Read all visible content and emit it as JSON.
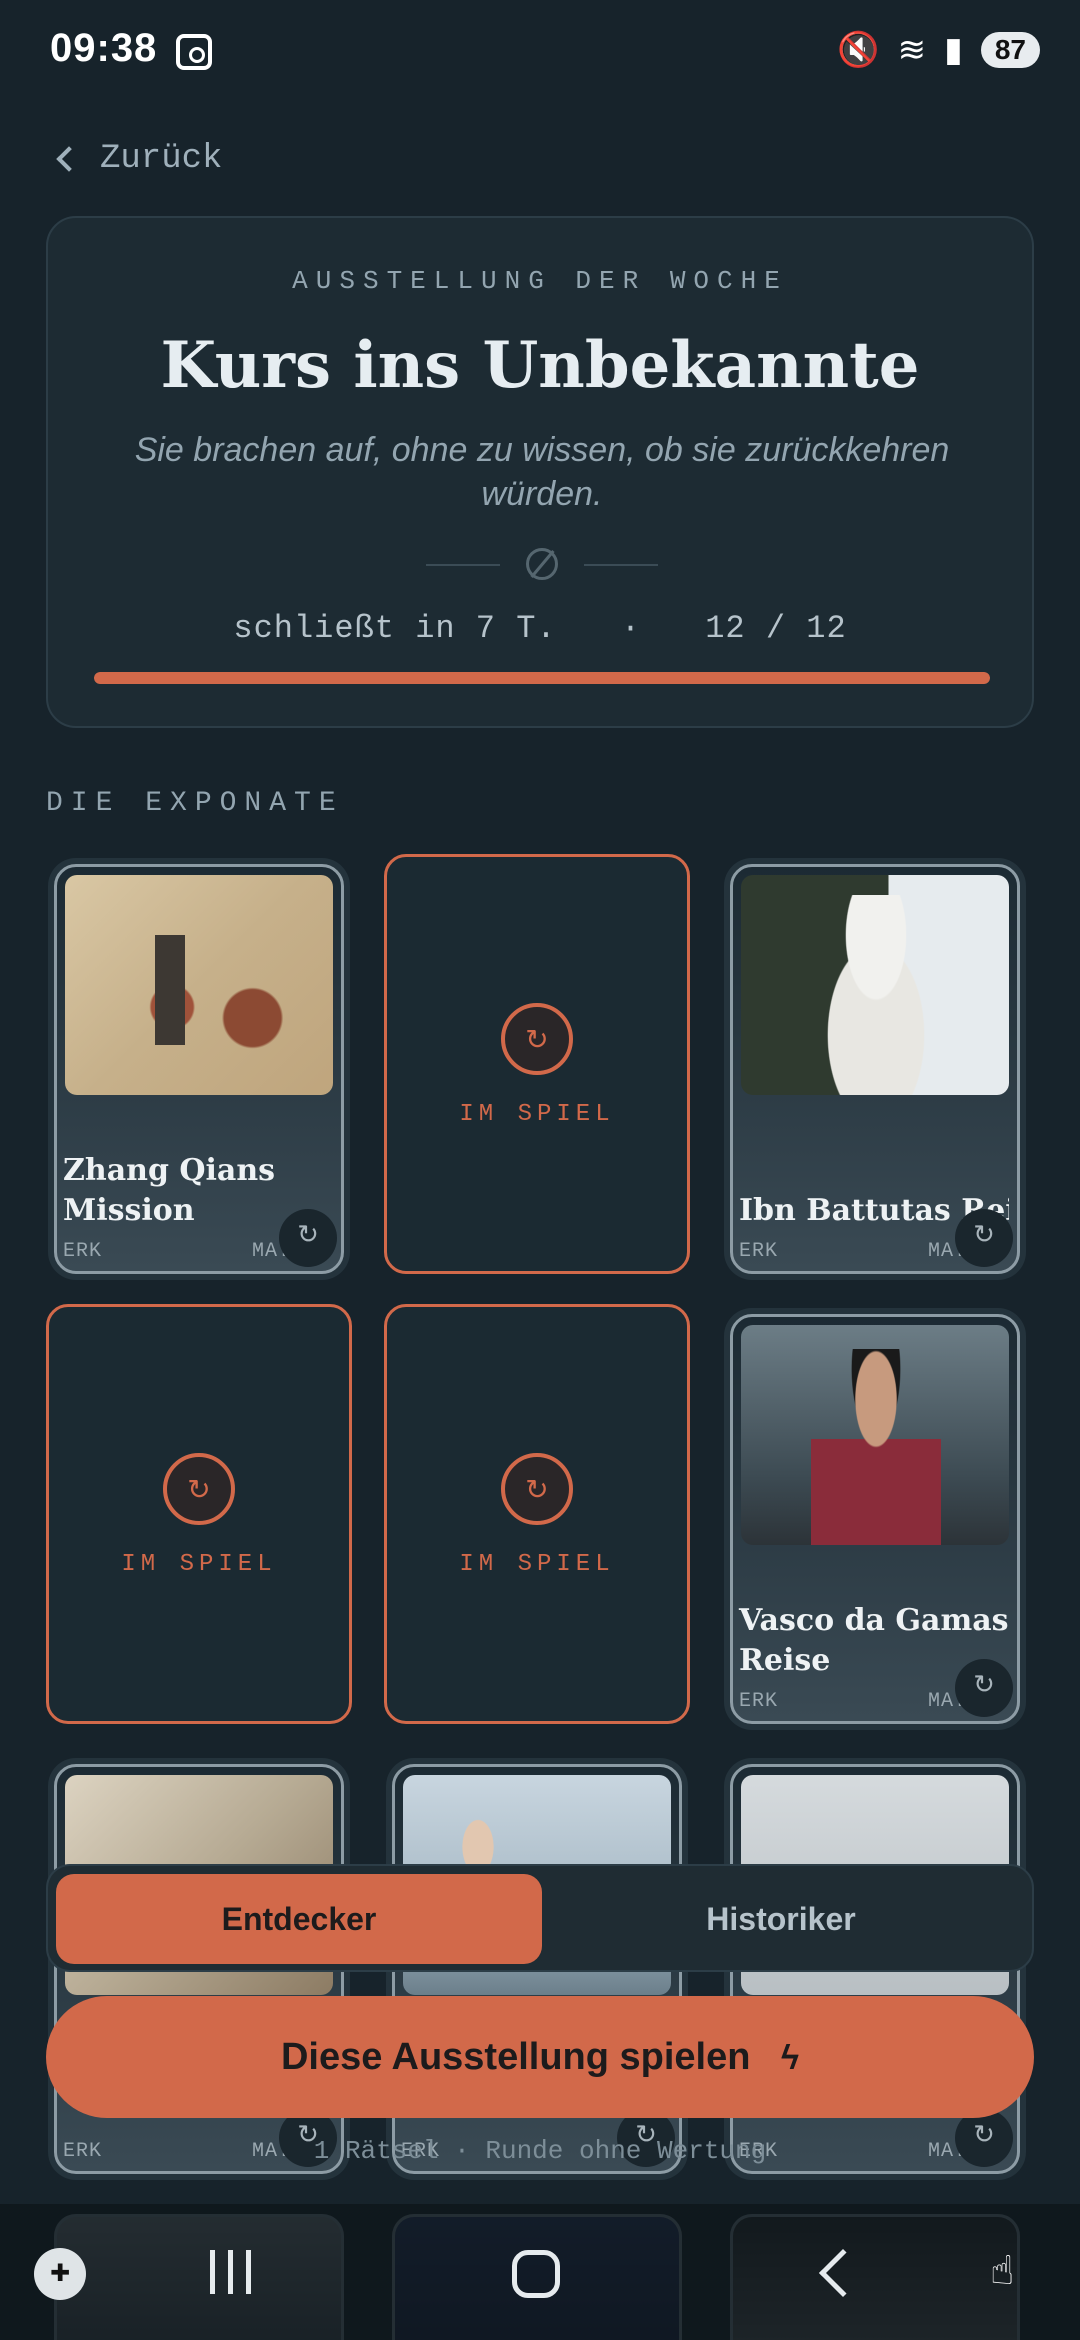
{
  "status": {
    "time": "09:38",
    "battery": "87"
  },
  "nav": {
    "back_label": "Zurück"
  },
  "hero": {
    "kicker": "AUSSTELLUNG DER WOCHE",
    "title": "Kurs ins Unbekannte",
    "subtitle": "Sie brachen auf, ohne zu wissen, ob sie zurückkehren würden.",
    "closes": "schließt in 7 T.",
    "separator": "·",
    "progress_text": "12 / 12",
    "progress_value": 1.0
  },
  "section": {
    "title": "DIE EXPONATE"
  },
  "cards": {
    "zhang": {
      "title": "Zhang Qians Mission",
      "left": "ERK",
      "right": "MA..."
    },
    "playing1": {
      "label": "IM SPIEL"
    },
    "ibn": {
      "title": "Ibn Battutas Rei...",
      "left": "ERK",
      "right": "MA..."
    },
    "playing2": {
      "label": "IM SPIEL"
    },
    "playing3": {
      "label": "IM SPIEL"
    },
    "vasco": {
      "title": "Vasco da Gamas Reise",
      "left": "ERK",
      "right": "MA..."
    },
    "row3a": {
      "left": "ERK",
      "right": "MA..."
    },
    "row3b": {
      "left": "ERK",
      "right": ""
    },
    "row3c": {
      "left": "ERK",
      "right": "MA..."
    }
  },
  "mode": {
    "active": "Entdecker",
    "inactive": "Historiker"
  },
  "cta": {
    "label": "Diese Ausstellung spielen"
  },
  "note": {
    "text": "1 Rätsel · Runde ohne Wertung"
  },
  "colors": {
    "accent": "#d2694a",
    "background": "#17232b",
    "card": "#1d2b33"
  }
}
